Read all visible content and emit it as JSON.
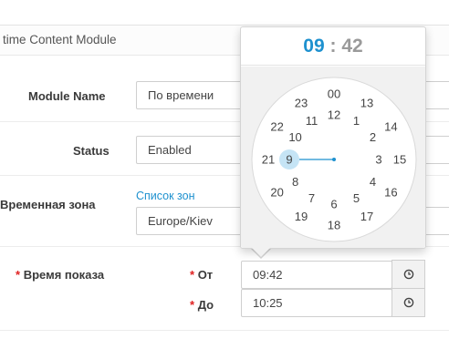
{
  "panel": {
    "title": "time Content Module"
  },
  "fields": {
    "module_name": {
      "label": "Module Name",
      "value": "По времени"
    },
    "status": {
      "label": "Status",
      "value": "Enabled"
    },
    "timezone": {
      "label": "Временная зона",
      "link": "Список зон",
      "value": "Europe/Kiev"
    },
    "show_time": {
      "required_mark": "*",
      "label": "Время показа",
      "from": {
        "required_mark": "*",
        "label": "От",
        "value": "09:42",
        "icon": "clock-icon"
      },
      "to": {
        "required_mark": "*",
        "label": "До",
        "value": "10:25",
        "icon": "clock-icon"
      }
    }
  },
  "clock": {
    "hours": "09",
    "separator": ":",
    "minutes": "42",
    "selected_hour": "9",
    "accent_color": "#1e91cf",
    "outer_ring": [
      "00",
      "13",
      "14",
      "15",
      "16",
      "17",
      "18",
      "19",
      "20",
      "21",
      "22",
      "23"
    ],
    "inner_ring": [
      "12",
      "1",
      "2",
      "3",
      "4",
      "5",
      "6",
      "7",
      "8",
      "9",
      "10",
      "11"
    ]
  }
}
